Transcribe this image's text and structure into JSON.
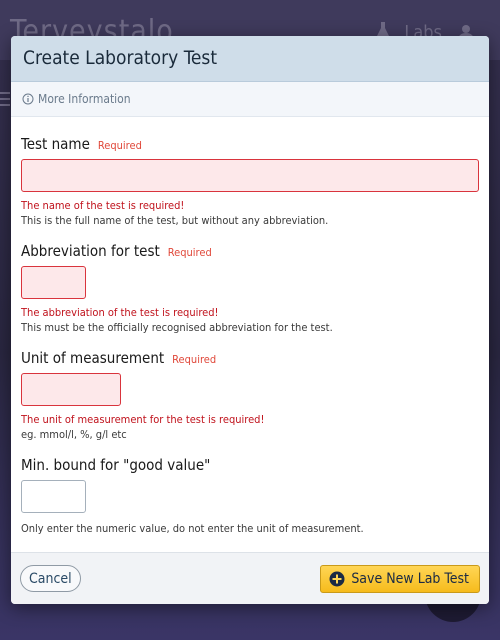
{
  "background": {
    "app_title": "Terveystalo",
    "labs_label": "Labs"
  },
  "modal": {
    "title": "Create Laboratory Test",
    "more_info": "More Information"
  },
  "fields": {
    "test_name": {
      "label": "Test name",
      "required": "Required",
      "value": "",
      "error": "The name of the test is required!",
      "help": "This is the full name of the test, but without any abbreviation."
    },
    "abbreviation": {
      "label": "Abbreviation for test",
      "required": "Required",
      "value": "",
      "error": "The abbreviation of the test is required!",
      "help": "This must be the officially recognised abbreviation for the test."
    },
    "unit": {
      "label": "Unit of measurement",
      "required": "Required",
      "value": "",
      "error": "The unit of measurement for the test is required!",
      "help": "eg. mmol/l, %, g/l etc"
    },
    "min_bound": {
      "label": "Min. bound for \"good value\"",
      "value": "",
      "help": "Only enter the numeric value, do not enter the unit of measurement."
    }
  },
  "footer": {
    "cancel_label": "Cancel",
    "save_label": "Save New Lab Test"
  },
  "colors": {
    "header_bg": "#cfdde9",
    "error": "#c0121c",
    "required": "#e0483a",
    "save_button": "#f6bb1c"
  },
  "icons": {
    "more_info": "info-circle-icon",
    "save": "plus-circle-icon"
  }
}
